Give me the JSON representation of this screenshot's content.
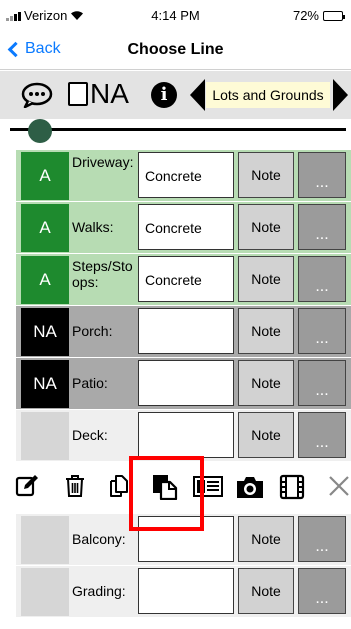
{
  "status": {
    "carrier": "Verizon",
    "time": "4:14 PM",
    "battery": "72%",
    "battery_level": 0.72
  },
  "nav": {
    "back_label": "Back",
    "title": "Choose Line"
  },
  "toolbar": {
    "na_label": "NA",
    "info_glyph": "i",
    "section": "Lots and Grounds"
  },
  "icons": [
    "comment-icon",
    "na-checkbox-icon",
    "info-icon",
    "previous-arrow-icon",
    "next-arrow-icon",
    "edit-icon",
    "trash-icon",
    "copy-icon",
    "paste-icon",
    "card-icon",
    "camera-icon",
    "film-icon",
    "close-icon"
  ],
  "rows": [
    {
      "badge": "A",
      "label": "Driveway:",
      "value": "Concrete",
      "note": "Note",
      "more": "...",
      "state": "green"
    },
    {
      "badge": "A",
      "label": "Walks:",
      "value": "Concrete",
      "note": "Note",
      "more": "...",
      "state": "green"
    },
    {
      "badge": "A",
      "label": "Steps/Stoops:",
      "value": "Concrete",
      "note": "Note",
      "more": "...",
      "state": "green"
    },
    {
      "badge": "NA",
      "label": "Porch:",
      "value": "",
      "note": "Note",
      "more": "...",
      "state": "gray"
    },
    {
      "badge": "NA",
      "label": "Patio:",
      "value": "",
      "note": "Note",
      "more": "...",
      "state": "gray"
    },
    {
      "badge": "",
      "label": "Deck:",
      "value": "",
      "note": "Note",
      "more": "...",
      "state": "plain"
    },
    {
      "badge": "",
      "label": "Balcony:",
      "value": "",
      "note": "Note",
      "more": "...",
      "state": "plain"
    },
    {
      "badge": "",
      "label": "Grading:",
      "value": "",
      "note": "Note",
      "more": "...",
      "state": "plain"
    }
  ],
  "colors": {
    "accent": "#0a7aff",
    "badge_a": "#1e8a2e",
    "highlight": "#ff0000",
    "section_bg": "#fefbd6"
  }
}
